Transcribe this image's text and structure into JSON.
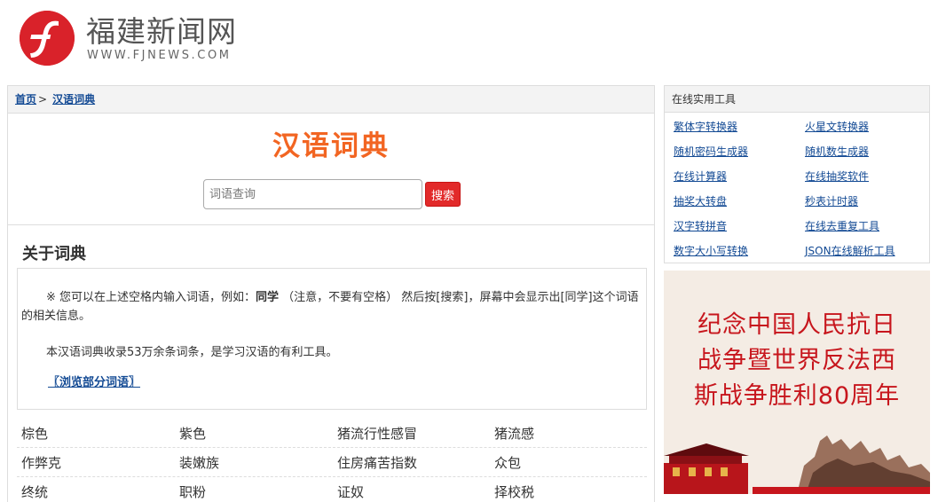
{
  "site": {
    "logo_cn": "福建新闻网",
    "logo_en": "WWW.FJNEWS.COM"
  },
  "breadcrumb": {
    "home": "首页",
    "separator": ">",
    "current": "汉语词典"
  },
  "hero": {
    "title": "汉语词典",
    "search_placeholder": "词语查询",
    "search_value": "",
    "search_button": "搜索"
  },
  "about": {
    "title": "关于词典",
    "p1_prefix": "※ 您可以在上述空格内输入词语，例如：",
    "p1_example": "同学",
    "p1_suffix": " （注意，不要有空格） 然后按[搜索]，屏幕中会显示出[同学]这个词语的相关信息。",
    "p2": "本汉语词典收录53万余条词条，是学习汉语的有利工具。",
    "browse_link": "〖浏览部分词语〗"
  },
  "words": [
    [
      "棕色",
      "紫色",
      "猪流行性感冒",
      "猪流感"
    ],
    [
      "作弊克",
      "装嫩族",
      "住房痛苦指数",
      "众包"
    ],
    [
      "终统",
      "职粉",
      "证奴",
      "择校税"
    ]
  ],
  "tools": {
    "title": "在线实用工具",
    "items": [
      [
        "繁体字转换器",
        "火星文转换器"
      ],
      [
        "随机密码生成器",
        "随机数生成器"
      ],
      [
        "在线计算器",
        "在线抽奖软件"
      ],
      [
        "抽奖大转盘",
        "秒表计时器"
      ],
      [
        "汉字转拼音",
        "在线去重复工具"
      ],
      [
        "数字大小写转换",
        "JSON在线解析工具"
      ]
    ]
  },
  "banner": {
    "line1": "纪念中国人民抗日",
    "line2": "战争暨世界反法西",
    "line3": "斯战争胜利80周年"
  },
  "colors": {
    "brand_red": "#d9222a",
    "title_orange": "#f26522",
    "link_blue": "#134a94",
    "button_red": "#e22a2a",
    "banner_red": "#c7161d"
  }
}
